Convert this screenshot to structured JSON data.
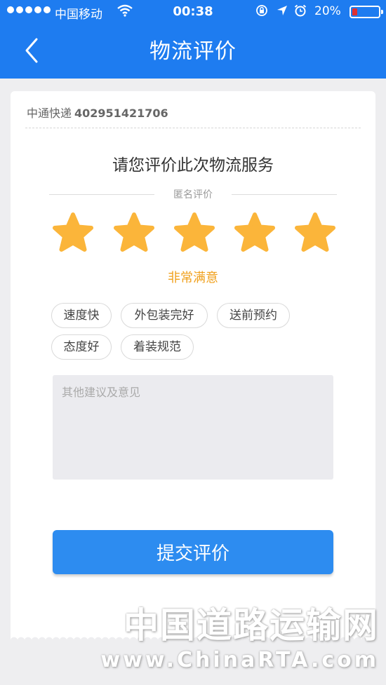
{
  "status_bar": {
    "carrier": "中国移动",
    "time": "00:38",
    "battery_percent": "20%",
    "battery_level": 0.2,
    "icons": [
      "signal-dots",
      "wifi-icon",
      "rotation-lock-icon",
      "location-icon",
      "alarm-icon",
      "battery-icon"
    ]
  },
  "nav": {
    "title": "物流评价",
    "back_icon": "chevron-left-icon"
  },
  "shipment": {
    "courier": "中通快递",
    "tracking_number": "402951421706"
  },
  "rating": {
    "prompt": "请您评价此次物流服务",
    "anonymous_label": "匿名评价",
    "stars_selected": 5,
    "stars_total": 5,
    "result_label": "非常满意",
    "star_color": "#fbb53a"
  },
  "tags": [
    {
      "label": "速度快"
    },
    {
      "label": "外包装完好"
    },
    {
      "label": "送前预约"
    },
    {
      "label": "态度好"
    },
    {
      "label": "着装规范"
    }
  ],
  "feedback": {
    "placeholder": "其他建议及意见",
    "value": ""
  },
  "submit": {
    "label": "提交评价"
  },
  "watermark": {
    "cn": "中国道路运输网",
    "en": "www.ChinaRTA.com"
  },
  "colors": {
    "nav_blue": "#1e7cf0",
    "button_blue": "#2d8cf0",
    "rating_orange": "#f0a01c",
    "battery_red": "#e03030"
  }
}
